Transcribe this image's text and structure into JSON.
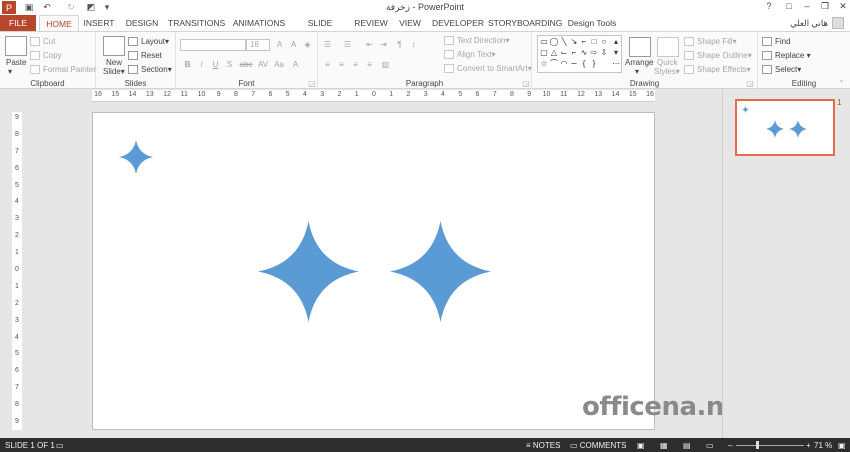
{
  "window": {
    "title": "زخرفة - PowerPoint",
    "controls": [
      "?",
      "□",
      "–",
      "❐",
      "✕"
    ]
  },
  "tabs": [
    "FILE",
    "HOME",
    "INSERT",
    "DESIGN",
    "TRANSITIONS",
    "ANIMATIONS",
    "SLIDE SHOW",
    "REVIEW",
    "VIEW",
    "DEVELOPER",
    "STORYBOARDING",
    "Design Tools"
  ],
  "active_tab": "HOME",
  "user": {
    "name": "هاني العلي"
  },
  "ribbon": {
    "clipboard": {
      "label": "Clipboard",
      "paste": "Paste",
      "cut": "Cut",
      "copy": "Copy",
      "format_painter": "Format Painter"
    },
    "slides": {
      "label": "Slides",
      "new_slide_1": "New",
      "new_slide_2": "Slide",
      "layout": "Layout",
      "reset": "Reset",
      "section": "Section"
    },
    "font": {
      "label": "Font",
      "size": "18",
      "buttons": [
        "B",
        "I",
        "U",
        "S",
        "abc",
        "AV",
        "Aa",
        "A"
      ]
    },
    "paragraph": {
      "label": "Paragraph",
      "text_direction": "Text Direction",
      "align_text": "Align Text",
      "convert_smartart": "Convert to SmartArt"
    },
    "drawing": {
      "label": "Drawing",
      "arrange": "Arrange",
      "quick_styles_1": "Quick",
      "quick_styles_2": "Styles",
      "shape_fill": "Shape Fill",
      "shape_outline": "Shape Outline",
      "shape_effects": "Shape Effects"
    },
    "editing": {
      "label": "Editing",
      "find": "Find",
      "replace": "Replace",
      "select": "Select"
    }
  },
  "hruler_ticks": [
    "16",
    "15",
    "14",
    "13",
    "12",
    "11",
    "10",
    "9",
    "8",
    "7",
    "6",
    "5",
    "4",
    "3",
    "2",
    "1",
    "0",
    "1",
    "2",
    "3",
    "4",
    "5",
    "6",
    "7",
    "8",
    "9",
    "10",
    "11",
    "12",
    "13",
    "14",
    "15",
    "16"
  ],
  "vruler_ticks": [
    "9",
    "8",
    "7",
    "6",
    "5",
    "4",
    "3",
    "2",
    "1",
    "0",
    "1",
    "2",
    "3",
    "4",
    "5",
    "6",
    "7",
    "8",
    "9"
  ],
  "slide": {
    "shape_color": "#5b9bd5"
  },
  "thumbnail": {
    "number": "1"
  },
  "watermark": "officena.net",
  "status": {
    "slide_info": "SLIDE 1 OF 1",
    "notes": "NOTES",
    "comments": "COMMENTS",
    "zoom": "71 %"
  }
}
